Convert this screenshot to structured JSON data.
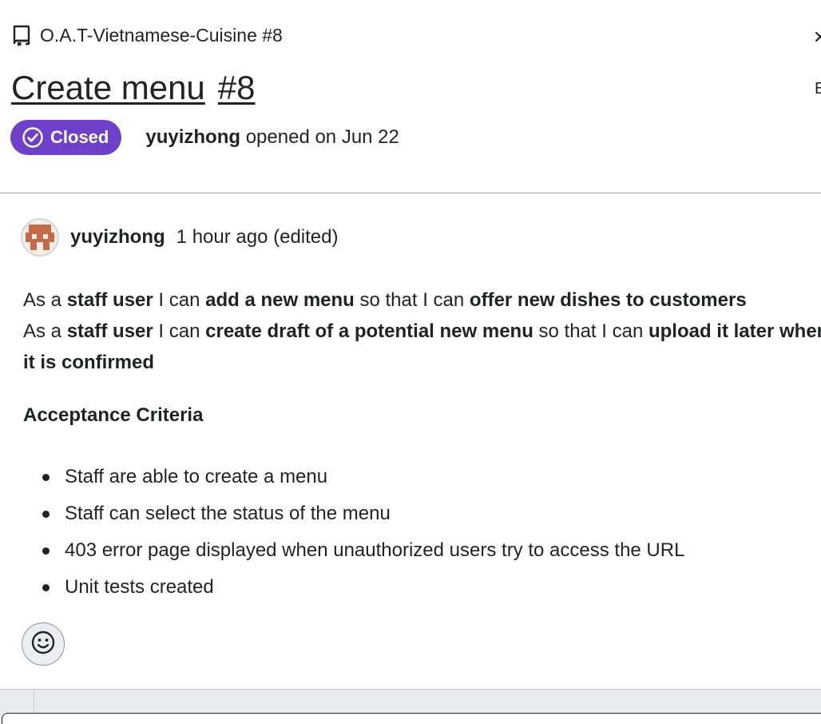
{
  "header": {
    "repo_icon": "repo-icon",
    "repo_name": "O.A.T-Vietnamese-Cuisine #8",
    "title": "Create menu",
    "number": "#8",
    "edge_letter": "E",
    "status": {
      "icon": "check-circle-icon",
      "label": "Closed",
      "color": "#6e40c9"
    },
    "opened_by": "yuyizhong",
    "opened_text": "opened on Jun 22"
  },
  "comment": {
    "author": "yuyizhong",
    "time": "1 hour ago (edited)",
    "story1": {
      "p1": "As a ",
      "b1": "staff user",
      "p2": " I can ",
      "b2": "add a new menu",
      "p3": " so that I can ",
      "b3": "offer new dishes to customers"
    },
    "story2": {
      "p1": "As a ",
      "b1": "staff user",
      "p2": " I can ",
      "b2": "create draft of a potential new menu",
      "p3": " so that I can ",
      "b3": "upload it later when it is confirmed"
    },
    "heading": "Acceptance Criteria",
    "criteria": [
      "Staff are able to create a menu",
      "Staff can select the status of the menu",
      "403 error page displayed when unauthorized users try to access the URL",
      "Unit tests created"
    ],
    "reaction_icon": "smiley-icon"
  }
}
